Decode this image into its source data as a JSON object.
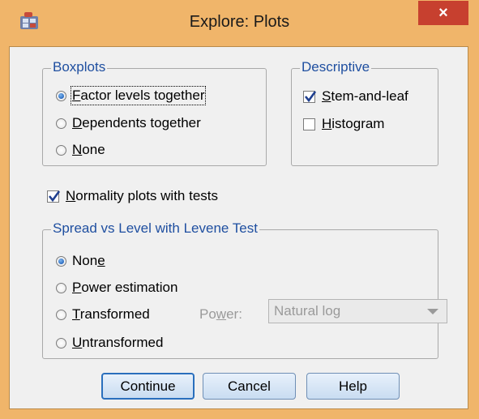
{
  "window": {
    "title": "Explore: Plots",
    "close_glyph": "×",
    "titlebar_color": "#f0b56a",
    "close_color": "#c7402f"
  },
  "boxplots": {
    "legend": "Boxplots",
    "options": [
      {
        "pre": "",
        "key": "F",
        "post": "actor levels together",
        "selected": true
      },
      {
        "pre": "",
        "key": "D",
        "post": "ependents together",
        "selected": false
      },
      {
        "pre": "",
        "key": "N",
        "post": "one",
        "selected": false
      }
    ]
  },
  "descriptive": {
    "legend": "Descriptive",
    "items": [
      {
        "pre": "",
        "key": "S",
        "post": "tem-and-leaf",
        "checked": true
      },
      {
        "pre": "",
        "key": "H",
        "post": "istogram",
        "checked": false
      }
    ]
  },
  "normality": {
    "pre": "",
    "key": "N",
    "post": "ormality plots with tests",
    "checked": true
  },
  "spread": {
    "legend": "Spread vs Level with Levene Test",
    "options": [
      {
        "pre": "Non",
        "key": "e",
        "post": "",
        "selected": true
      },
      {
        "pre": "",
        "key": "P",
        "post": "ower estimation",
        "selected": false
      },
      {
        "pre": "",
        "key": "T",
        "post": "ransformed",
        "selected": false
      },
      {
        "pre": "",
        "key": "U",
        "post": "ntransformed",
        "selected": false
      }
    ],
    "power_label": {
      "pre": "Po",
      "key": "w",
      "post": "er:"
    },
    "power_value": "Natural log"
  },
  "buttons": {
    "continue": "Continue",
    "cancel": "Cancel",
    "help": "Help"
  }
}
